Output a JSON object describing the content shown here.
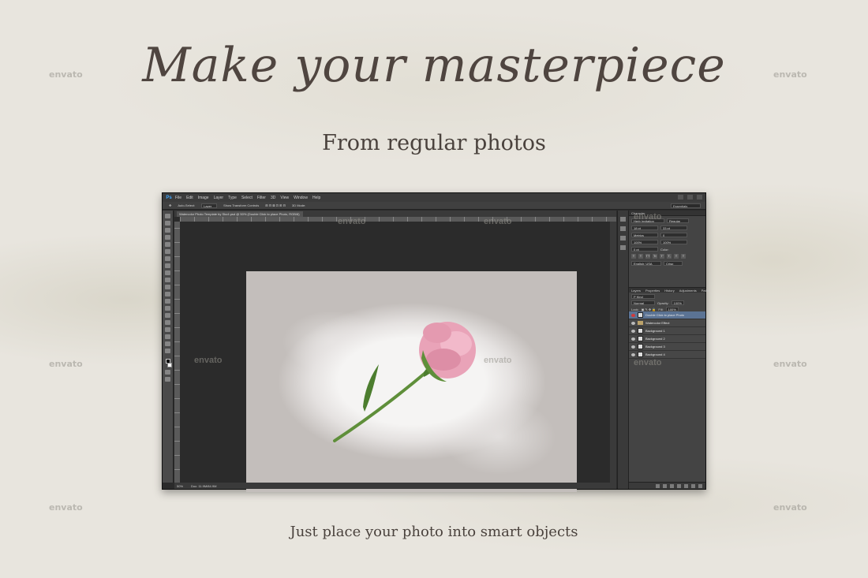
{
  "headline": "Make your masterpiece",
  "subhead": "From regular photos",
  "footer": "Just place your photo into smart objects",
  "watermark": "envato",
  "photoshop": {
    "menu": [
      "File",
      "Edit",
      "Image",
      "Layer",
      "Type",
      "Select",
      "Filter",
      "3D",
      "View",
      "Window",
      "Help"
    ],
    "options": {
      "auto_select_label": "Auto-Select:",
      "auto_select_value": "Layer",
      "transform_label": "Show Transform Controls",
      "mode_3d_label": "3D Mode:",
      "workspace": "Essentials"
    },
    "document_tab": "Watercolor Photo Template by Sko4.psd @ 50% (Double Click to place Photo, RGB/8)",
    "status": {
      "zoom": "50%",
      "doc_size": "Doc: 11.9M/84.9M"
    },
    "character_panel": {
      "title": "Character",
      "font_family": "Herb Invitation",
      "font_style": "Regular",
      "font_size": "18 pt",
      "leading": "33 pt",
      "kerning": "Metrics",
      "tracking": "0",
      "vertical_scale": "100%",
      "horizontal_scale": "100%",
      "baseline": "0 pt",
      "color_label": "Color:",
      "language": "English: USA",
      "antialias": "Crisp",
      "glyphs": [
        "T",
        "T",
        "TT",
        "Tr",
        "T'",
        "T,",
        "T",
        "T"
      ]
    },
    "layers_panel": {
      "tabs": [
        "Layers",
        "Properties",
        "History",
        "Adjustments",
        "Paths"
      ],
      "filter": "P Kind",
      "blend_mode": "Normal",
      "opacity_label": "Opacity:",
      "opacity": "100%",
      "lock_label": "Lock:",
      "fill_label": "Fill:",
      "fill": "100%",
      "layers": [
        {
          "name": "Double Click to place Photo",
          "type": "smart",
          "active": true
        },
        {
          "name": "Watercolor Effect",
          "type": "folder",
          "active": false
        },
        {
          "name": "Background 1",
          "type": "layer",
          "active": false
        },
        {
          "name": "Background 2",
          "type": "layer",
          "active": false
        },
        {
          "name": "Background 3",
          "type": "layer",
          "active": false
        },
        {
          "name": "Background 4",
          "type": "layer",
          "active": false
        }
      ]
    }
  }
}
